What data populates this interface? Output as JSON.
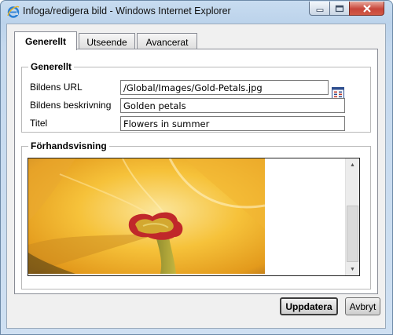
{
  "window": {
    "title": "Infoga/redigera bild - Windows Internet Explorer"
  },
  "tabs": [
    {
      "label": "Generellt",
      "active": true
    },
    {
      "label": "Utseende",
      "active": false
    },
    {
      "label": "Avancerat",
      "active": false
    }
  ],
  "general": {
    "legend": "Generellt",
    "url_label": "Bildens URL",
    "url_value": "/Global/Images/Gold-Petals.jpg",
    "description_label": "Bildens beskrivning",
    "description_value": "Golden petals",
    "title_label": "Titel",
    "title_value": "Flowers in summer"
  },
  "preview": {
    "legend": "Förhandsvisning"
  },
  "buttons": {
    "update": "Uppdatera",
    "cancel": "Avbryt"
  }
}
